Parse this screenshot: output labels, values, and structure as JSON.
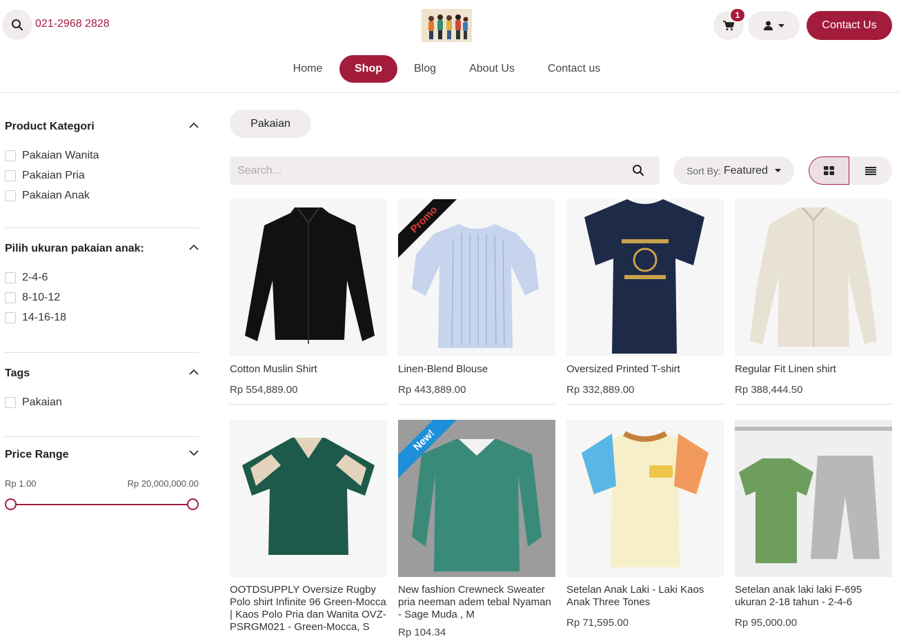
{
  "header": {
    "phone": "021-2968 2828",
    "cart_count": "1",
    "contact_button": "Contact Us"
  },
  "nav": {
    "items": [
      "Home",
      "Shop",
      "Blog",
      "About Us",
      "Contact us"
    ],
    "active": "Shop"
  },
  "sidebar": {
    "category": {
      "title": "Product Kategori",
      "options": [
        "Pakaian Wanita",
        "Pakaian Pria",
        "Pakaian Anak"
      ]
    },
    "size": {
      "title": "Pilih ukuran pakaian anak:",
      "options": [
        "2-4-6",
        "8-10-12",
        "14-16-18"
      ]
    },
    "tags": {
      "title": "Tags",
      "options": [
        "Pakaian"
      ]
    },
    "price": {
      "title": "Price Range",
      "min_label": "Rp 1.00",
      "max_label": "Rp 20,000,000.00"
    }
  },
  "main": {
    "active_chip": "Pakaian",
    "search_placeholder": "Search...",
    "sort_prefix": "Sort By:",
    "sort_value": "Featured",
    "products": [
      {
        "name": "Cotton Muslin Shirt",
        "price": "Rp 554,889.00",
        "ribbon": "",
        "icon": "black-shirt-icon"
      },
      {
        "name": "Linen-Blend Blouse",
        "price": "Rp 443,889.00",
        "ribbon": "Promo",
        "icon": "blue-blouse-icon"
      },
      {
        "name": "Oversized Printed T-shirt",
        "price": "Rp 332,889.00",
        "ribbon": "",
        "icon": "navy-tshirt-icon"
      },
      {
        "name": "Regular Fit Linen shirt",
        "price": "Rp 388,444.50",
        "ribbon": "",
        "icon": "beige-shirt-icon"
      },
      {
        "name": "OOTDSUPPLY Oversize Rugby Polo shirt Infinite 96 Green-Mocca | Kaos Polo Pria dan Wanita OVZ-PSRGM021 - Green-Mocca, S",
        "price": "",
        "ribbon": "",
        "icon": "green-polo-icon"
      },
      {
        "name": "New fashion Crewneck Sweater pria neeman adem tebal Nyaman - Sage Muda , M",
        "price": "Rp 104.34",
        "ribbon": "New!",
        "icon": "green-sweater-icon"
      },
      {
        "name": "Setelan Anak Laki - Laki Kaos Anak Three Tones",
        "price": "Rp 71,595.00",
        "ribbon": "",
        "icon": "kids-tshirt-icon"
      },
      {
        "name": "Setelan anak laki laki F-695 ukuran 2-18 tahun - 2-4-6",
        "price": "Rp 95,000.00",
        "ribbon": "",
        "icon": "kids-set-icon"
      }
    ]
  },
  "colors": {
    "brand": "#a31c3c",
    "chip_bg": "#f1eded",
    "promo_ribbon": "#111111",
    "new_ribbon": "#1e8fd8"
  }
}
